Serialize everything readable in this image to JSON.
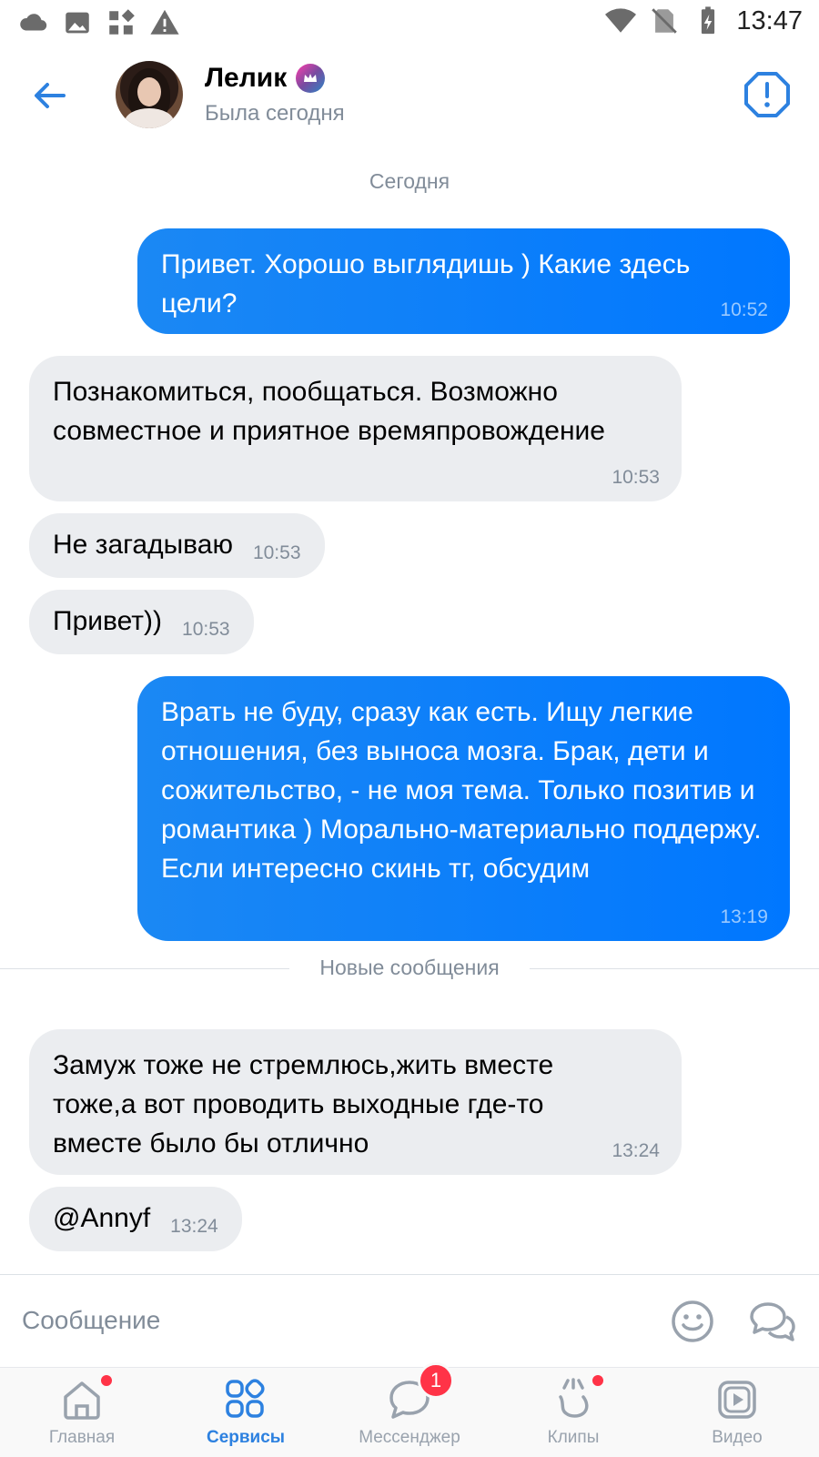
{
  "status_bar": {
    "time": "13:47",
    "left_icons": [
      "cloud-icon",
      "image-icon",
      "apps-icon",
      "warning-icon"
    ],
    "right_icons": [
      "wifi-icon",
      "no-sim-icon",
      "battery-icon"
    ]
  },
  "header": {
    "contact_name": "Лелик",
    "contact_status": "Была сегодня",
    "badge_icon": "crown-icon",
    "accent": "#2d81e0"
  },
  "chat": {
    "date_label": "Сегодня",
    "new_messages_label": "Новые сообщения",
    "messages": [
      {
        "dir": "out",
        "text": "Привет. Хорошо выглядишь ) Какие здесь цели?",
        "time": "10:52"
      },
      {
        "dir": "in",
        "text": "Познакомиться, пообщаться. Возможно совместное и приятное времяпровождение",
        "time": "10:53"
      },
      {
        "dir": "in",
        "text": "Не загадываю",
        "time": "10:53"
      },
      {
        "dir": "in",
        "text": "Привет))",
        "time": "10:53"
      },
      {
        "dir": "out",
        "text": "Врать не буду, сразу как есть. Ищу легкие отношения, без выноса мозга. Брак, дети и сожительство, - не моя тема. Только позитив и романтика ) Морально-материально поддержу. Если интересно скинь тг, обсудим",
        "time": "13:19"
      },
      {
        "dir": "in",
        "text": "Замуж тоже не стремлюсь,жить вместе тоже,а вот проводить выходные где-то вместе было бы отлично",
        "time": "13:24"
      },
      {
        "dir": "in",
        "text": "@Annyf",
        "time": "13:24"
      }
    ]
  },
  "composer": {
    "placeholder": "Сообщение"
  },
  "bottom_nav": {
    "items": [
      {
        "label": "Главная",
        "icon": "home-icon",
        "dot": true
      },
      {
        "label": "Сервисы",
        "icon": "services-icon",
        "active": true
      },
      {
        "label": "Мессенджер",
        "icon": "messenger-icon",
        "badge": "1"
      },
      {
        "label": "Клипы",
        "icon": "clips-icon",
        "dot": true
      },
      {
        "label": "Видео",
        "icon": "video-icon"
      }
    ]
  }
}
